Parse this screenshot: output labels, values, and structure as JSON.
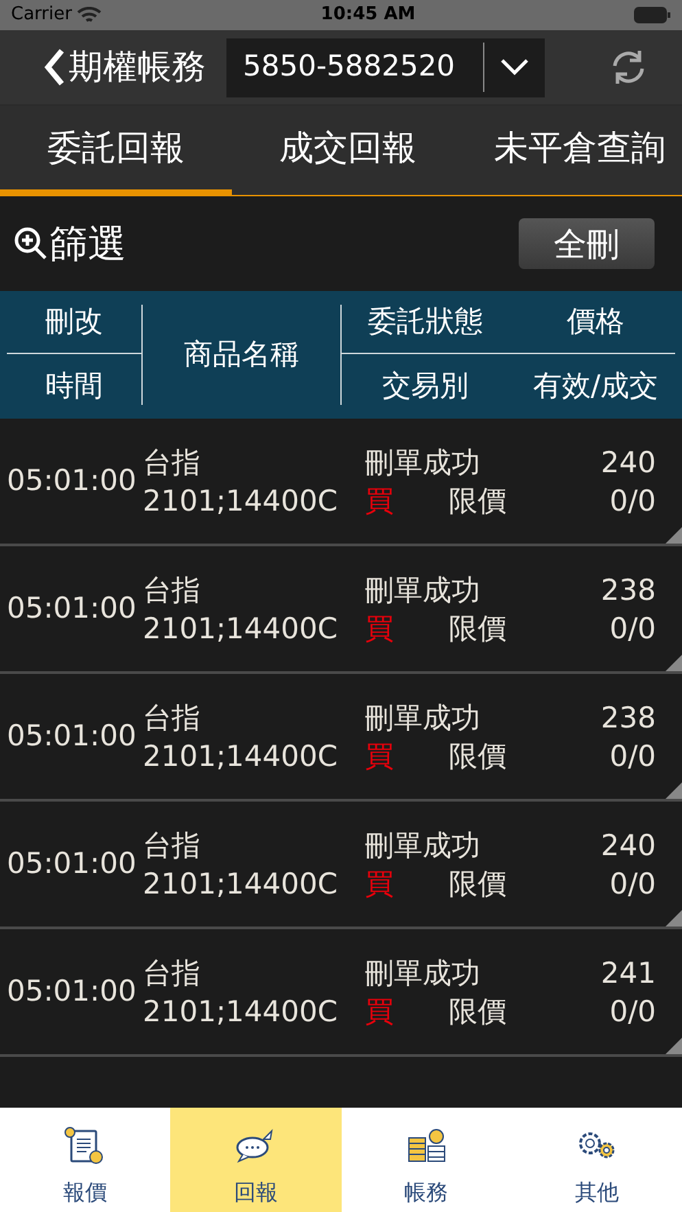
{
  "status_bar": {
    "carrier": "Carrier",
    "time": "10:45 AM"
  },
  "header": {
    "back_label": "期權帳務",
    "account": "5850-5882520"
  },
  "tabs": [
    {
      "label": "委託回報",
      "selected": true
    },
    {
      "label": "成交回報",
      "selected": false
    },
    {
      "label": "未平倉查詢",
      "selected": false
    }
  ],
  "filter": {
    "label": "篩選",
    "delete_all": "全刪"
  },
  "table": {
    "columns": {
      "top_left": "刪改",
      "bottom_left": "時間",
      "name": "商品名稱",
      "top_mid": "委託狀態",
      "top_right": "價格",
      "bottom_mid": "交易別",
      "bottom_right": "有效/成交"
    },
    "rows": [
      {
        "time": "05:01:00",
        "name": "台指",
        "contract": "2101;14400C",
        "status": "刪單成功",
        "side": "買",
        "order_type": "限價",
        "price": "240",
        "filled": "0/0"
      },
      {
        "time": "05:01:00",
        "name": "台指",
        "contract": "2101;14400C",
        "status": "刪單成功",
        "side": "買",
        "order_type": "限價",
        "price": "238",
        "filled": "0/0"
      },
      {
        "time": "05:01:00",
        "name": "台指",
        "contract": "2101;14400C",
        "status": "刪單成功",
        "side": "買",
        "order_type": "限價",
        "price": "238",
        "filled": "0/0"
      },
      {
        "time": "05:01:00",
        "name": "台指",
        "contract": "2101;14400C",
        "status": "刪單成功",
        "side": "買",
        "order_type": "限價",
        "price": "240",
        "filled": "0/0"
      },
      {
        "time": "05:01:00",
        "name": "台指",
        "contract": "2101;14400C",
        "status": "刪單成功",
        "side": "買",
        "order_type": "限價",
        "price": "241",
        "filled": "0/0"
      }
    ]
  },
  "tab_bar": [
    {
      "kind": "quote",
      "label": "報價",
      "selected": false
    },
    {
      "kind": "report",
      "label": "回報",
      "selected": true
    },
    {
      "kind": "account",
      "label": "帳務",
      "selected": false
    },
    {
      "kind": "other",
      "label": "其他",
      "selected": false
    }
  ]
}
